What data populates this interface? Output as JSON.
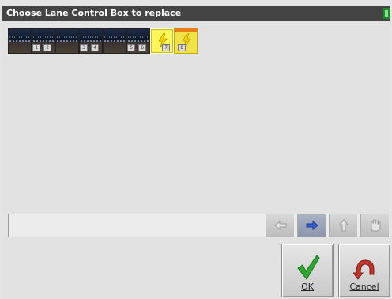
{
  "window": {
    "title": "Choose Lane Control Box to replace"
  },
  "boxes": [
    {
      "label": "1",
      "style": "dark"
    },
    {
      "label": "2",
      "style": "dark"
    },
    {
      "label": "3",
      "style": "dark"
    },
    {
      "label": "4",
      "style": "dark"
    },
    {
      "label": "5",
      "style": "dark"
    },
    {
      "label": "6",
      "style": "dark"
    },
    {
      "label": "7",
      "style": "yellow-selected"
    },
    {
      "label": "8",
      "style": "yellow-orange"
    }
  ],
  "colors": {
    "title_bg": "#444444",
    "content_bg": "#e2e2e2",
    "ok_green": "#2fa82f",
    "cancel_red": "#c0342a",
    "tile_yellow": "#f1e14a",
    "tile_orange": "#e87e14"
  },
  "nav": {
    "icons": [
      "arrow-left-icon",
      "arrow-right-icon",
      "arrow-up-icon",
      "hand-icon"
    ]
  },
  "buttons": {
    "ok_label": "OK",
    "cancel_label": "Cancel",
    "ok_icon": "checkmark-icon",
    "cancel_icon": "undo-arrow-icon"
  }
}
